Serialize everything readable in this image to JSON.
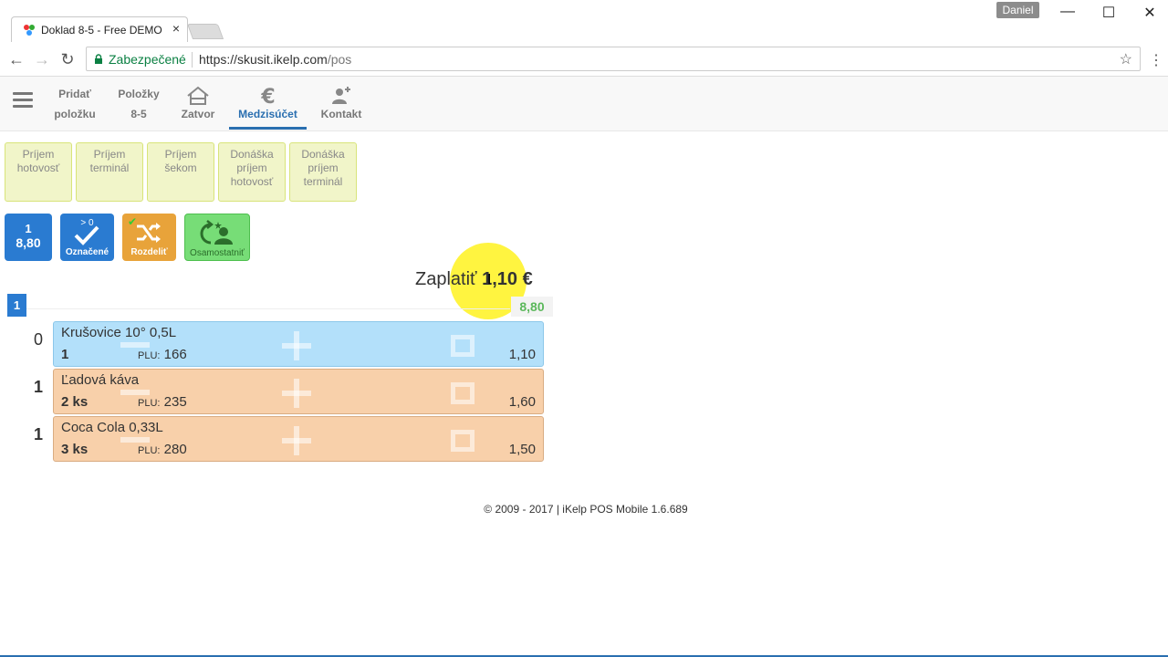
{
  "browser": {
    "tab_title": "Doklad 8-5 - Free DEMO",
    "profile_name": "Daniel",
    "secure_label": "Zabezpečené",
    "url_host": "https://skusit.ikelp.com",
    "url_path": "/pos"
  },
  "nav": {
    "add_item": {
      "line1": "Pridať",
      "line2": "položku"
    },
    "items": {
      "line1": "Položky",
      "line2": "8-5"
    },
    "close": "Zatvor",
    "subtotal": "Medzisúčet",
    "contact": "Kontakt"
  },
  "payment_buttons": [
    {
      "label1": "Príjem",
      "label2": "hotovosť",
      "label3": ""
    },
    {
      "label1": "Príjem",
      "label2": "terminál",
      "label3": ""
    },
    {
      "label1": "Príjem",
      "label2": "šekom",
      "label3": ""
    },
    {
      "label1": "Donáška",
      "label2": "príjem",
      "label3": "hotovosť"
    },
    {
      "label1": "Donáška",
      "label2": "príjem",
      "label3": "terminál"
    }
  ],
  "actions": {
    "group_count": "1",
    "group_total": "8,80",
    "marked_badge": "> 0",
    "marked_label": "Označené",
    "split_label": "Rozdeliť",
    "separate_label": "Osamostatniť"
  },
  "summary": {
    "pay_label": "Zaplatiť",
    "pay_amount": "1,10",
    "currency": "€",
    "group_number": "1",
    "group_subtotal": "8,80"
  },
  "items": [
    {
      "row": "0",
      "name": "Krušovice 10° 0,5L",
      "qty": "1",
      "plu_label": "PLU:",
      "plu": "166",
      "price": "1,10",
      "state": "selected"
    },
    {
      "row": "1",
      "name": "Ľadová káva",
      "qty": "2 ks",
      "plu_label": "PLU:",
      "plu": "235",
      "price": "1,60",
      "state": "normal"
    },
    {
      "row": "1",
      "name": "Coca Cola 0,33L",
      "qty": "3 ks",
      "plu_label": "PLU:",
      "plu": "280",
      "price": "1,50",
      "state": "normal"
    }
  ],
  "footer": "© 2009 - 2017 | iKelp POS Mobile 1.6.689",
  "colors": {
    "accent": "#2a6fb0",
    "selected_item": "#b3e0fa",
    "normal_item": "#f8d0aa",
    "payment_button": "#f1f5c9",
    "split_button": "#e8a33a",
    "separate_button": "#77dd77"
  }
}
